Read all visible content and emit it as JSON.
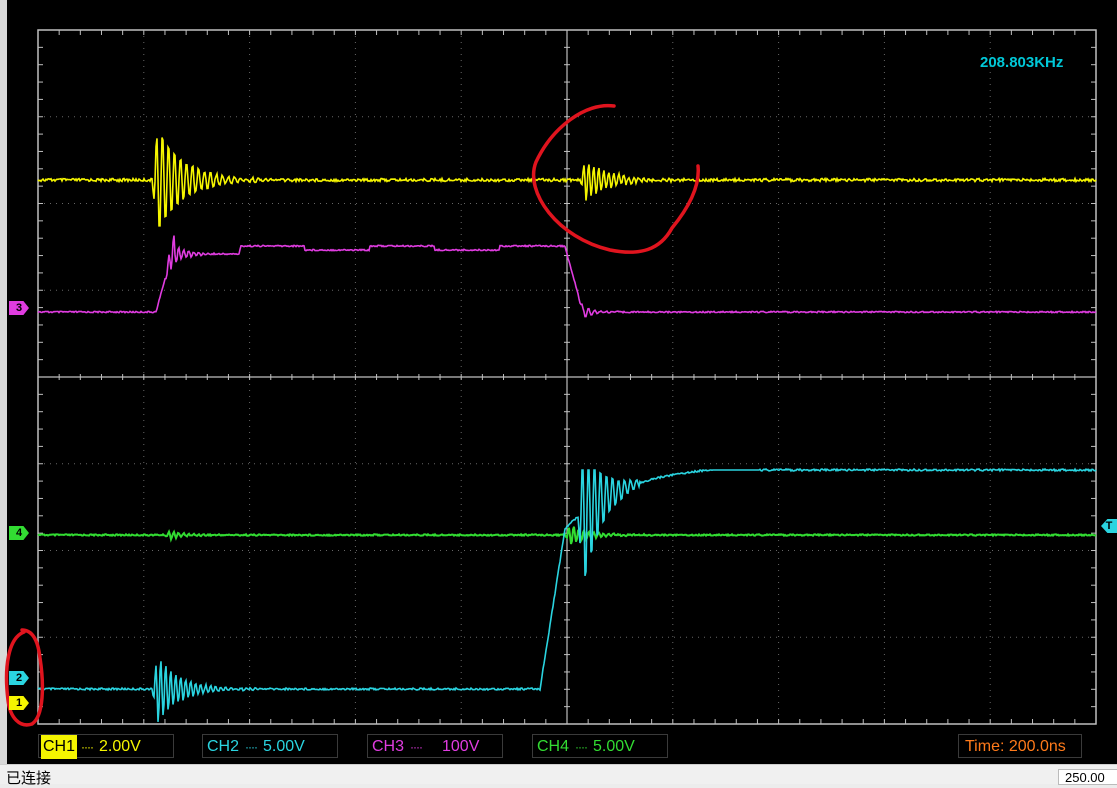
{
  "frequency": "208.803KHz",
  "channels": [
    {
      "name": "CH1",
      "coupling": "····",
      "scale": "2.00V",
      "color": "#f5f500",
      "active": true
    },
    {
      "name": "CH2",
      "coupling": "····",
      "scale": "5.00V",
      "color": "#2ad4e0",
      "active": false
    },
    {
      "name": "CH3",
      "coupling": "····",
      "scale": "100V",
      "color": "#e03ce0",
      "active": false
    },
    {
      "name": "CH4",
      "coupling": "····",
      "scale": "5.00V",
      "color": "#32dc32",
      "active": false
    }
  ],
  "markers": {
    "ch1": "1",
    "ch2": "2",
    "ch3": "3",
    "ch4": "4",
    "trigger": "T"
  },
  "time_base": "Time: 200.0ns",
  "status": {
    "text": "已连接",
    "right_field": "250.00"
  },
  "annotation_color": "#e0141e"
}
